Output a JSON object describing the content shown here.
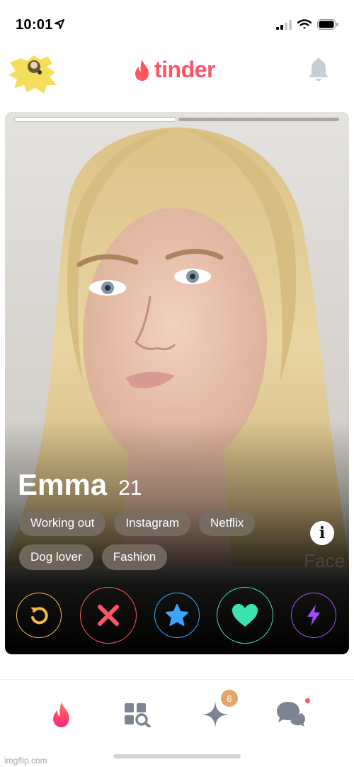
{
  "status_bar": {
    "time": "10:01"
  },
  "header": {
    "logo_text": "tinder"
  },
  "card": {
    "name": "Emma",
    "age": "21",
    "interests": [
      "Working out",
      "Instagram",
      "Netflix",
      "Dog lover",
      "Fashion"
    ],
    "info_label": "i",
    "faint_text": "Face",
    "photo_segments": 2,
    "active_segment": 1
  },
  "actions": [
    "rewind",
    "nope",
    "super-like",
    "like",
    "boost"
  ],
  "bottom_nav": {
    "items": [
      "discover",
      "explore",
      "top-picks",
      "messages"
    ],
    "top_picks_badge": "6"
  },
  "watermark": "imgflip.com",
  "colors": {
    "brand": "#fd5564",
    "rewind": "#f5b748",
    "nope": "#fd5564",
    "super_like": "#3ca4ff",
    "like": "#3ce2b0",
    "boost": "#a34dff",
    "badge": "#e3a66a"
  }
}
